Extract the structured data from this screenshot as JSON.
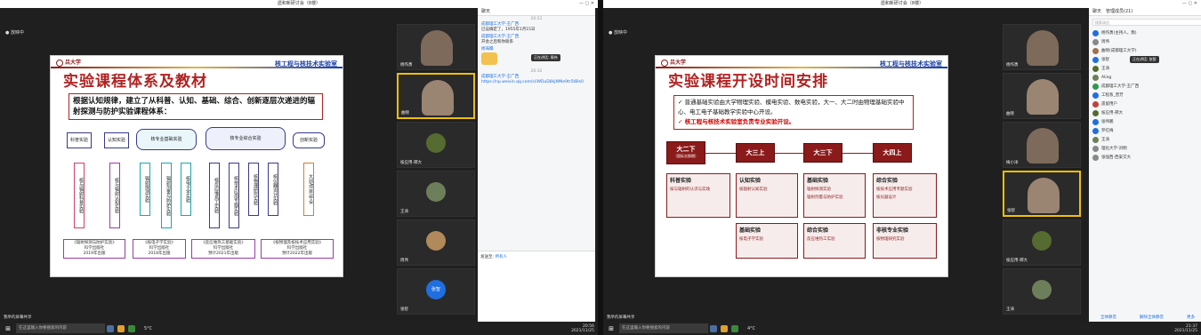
{
  "left": {
    "window_title": "遗和新研讨会（8楼）",
    "share_label": "放映中",
    "slide": {
      "logo_text": "吕大学",
      "dept": "核工程与核技术实验室",
      "title": "实验课程体系及教材",
      "intro": "根据认知规律，建立了从科普、认知、基础、综合、创新逐层次递进的辐射探测与防护实验课程体系：",
      "top_boxes": [
        "科普实验",
        "认知实验",
        "核专业基础实验",
        "核专业综合实验",
        "创新实验"
      ],
      "columns": [
        "核与辐射科普实验",
        "核与辐射认知实验",
        "辐射探测实验",
        "辐射剂量与防护实验",
        "核电子学实验",
        "核反应堆热工实验",
        "核技术应用专题实验",
        "核物理研究实验",
        "核仪器设计实验",
        "大创/项目/毕设"
      ],
      "books": [
        [
          "《辐射探测与防护实验》",
          "科学出版社",
          "2019年出版"
        ],
        [
          "《核电子学实验》",
          "科学出版社",
          "2018年出版"
        ],
        [
          "《反应堆热工基础实验》",
          "科学出版社",
          "预计2021年出版"
        ],
        [
          "《核物理及核技术应用实验》",
          "科学出版社",
          "预计2022年出版"
        ]
      ]
    },
    "videos": [
      {
        "name": "杨作勇"
      },
      {
        "name": "曲晓"
      },
      {
        "name": "核应用-邢大"
      },
      {
        "name": "王涛"
      },
      {
        "name": "周伟"
      },
      {
        "name": "张智",
        "initials": "张智"
      }
    ],
    "chat": {
      "header": "聊天",
      "messages": [
        {
          "time": "20:22",
          "who": "成都理工大学-王广西",
          "text": "已设确定了，1955年1月15日"
        },
        {
          "who": "成都理工大学-王广西",
          "text": "开会之后和你联系"
        },
        {
          "who": "杨海鹰",
          "text": ""
        },
        {
          "time": "20:32",
          "who": "成都理工大学-王广西",
          "link": "https://np.weixin.qq.com/s/iWDuD8kJWNe9tr5tBIs0"
        }
      ],
      "toast": "正在讲话: 周伟",
      "send_to_label": "发送至:",
      "send_to_value": "所有人"
    },
    "sharebar": "我举的屏幕共享",
    "taskbar": {
      "search": "在这里输入你要搜索的内容",
      "weather": "5°C",
      "time": "20:56",
      "date": "2021/11/25"
    }
  },
  "right": {
    "window_title": "遗和新研讨会（8楼）",
    "share_label": "放映中",
    "slide": {
      "logo_text": "吕大学",
      "dept": "核工程与核技术实验室",
      "title": "实验课程开设时间安排",
      "bullet1": "普通基础实验由大学物理实验、模电实验、数电实验，大一、大二时由物理基础实验中心、电工电子基础教学实验中心开设。",
      "bullet2": "核工程与核技术实验室负责专业实验开设。",
      "stages": [
        {
          "label": "大二下",
          "sub": "（国际交换期）"
        },
        {
          "label": "大三上"
        },
        {
          "label": "大三下"
        },
        {
          "label": "大四上"
        }
      ],
      "panels": [
        {
          "h": "科普实验",
          "items": [
            "核与辐射的认识与实践"
          ]
        },
        {
          "h": "认知实验",
          "items": [
            "核辐射认知实验"
          ]
        },
        {
          "h": "基础实验",
          "items": [
            "辐射探测实验",
            "辐射剂量与防护实验"
          ]
        },
        {
          "h": "综合实验",
          "items": [
            "核技术应用专题实验",
            "核仪器设计"
          ]
        },
        {
          "h": "基础实验",
          "items": [
            "核电子学实验"
          ]
        },
        {
          "h": "综合实验",
          "items": [
            "反应堆热工实验"
          ]
        },
        {
          "h": "非核专业实验",
          "items": [
            "核物理研究实验"
          ]
        }
      ]
    },
    "videos": [
      {
        "name": "杨作勇"
      },
      {
        "name": "曲晓"
      },
      {
        "name": "梅小洋"
      },
      {
        "name": "张智"
      },
      {
        "name": "核应用-邢大"
      },
      {
        "name": "王涛"
      }
    ],
    "participants": {
      "tab1": "聊天",
      "tab2": "管理成员(21)",
      "search": "搜索成员",
      "list": [
        "杨作勇(主持人，我)",
        "周伟",
        "曲晓(成都理工大学)",
        "张智",
        "王涛",
        "Aling",
        "成都理工大学-王广西",
        "工程系_曾芳",
        "遗留用户",
        "核应用-邢大",
        "张伟鹏",
        "罗红梅",
        "王涛",
        "理化大学-刘明",
        "张强西-西安交大"
      ],
      "toast": "正在讲话: 张智",
      "btn_invite": "全体静音",
      "btn_mute": "解除全体静音",
      "btn_more": "更多"
    },
    "sharebar": "我举的屏幕共享",
    "taskbar": {
      "search": "在这里输入你要搜索的内容",
      "weather": "4°C",
      "time": "21:37",
      "date": "2021/11/25"
    }
  }
}
